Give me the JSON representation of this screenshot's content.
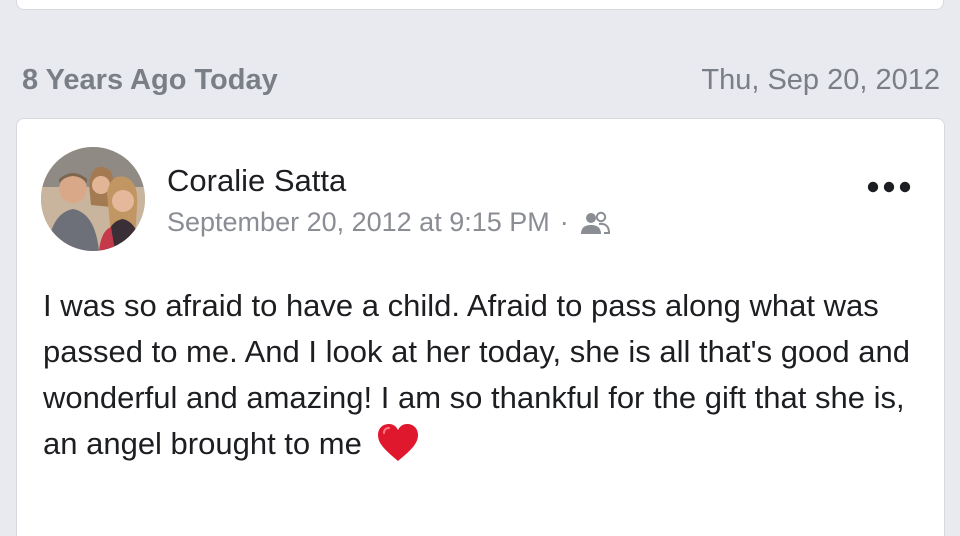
{
  "memory": {
    "label": "8 Years Ago Today",
    "date": "Thu, Sep 20, 2012"
  },
  "post": {
    "author": "Coralie Satta",
    "timestamp": "September 20, 2012 at 9:15 PM",
    "separator": "·",
    "audience_icon": "friends-icon",
    "more_icon": "more-options-icon",
    "text": "I was so afraid to have a child. Afraid to pass along what was passed to me. And I look at her today, she is all that's good and wonderful and amazing! I am so thankful for the gift that she is, an angel brought to me",
    "emoji_icon": "red-heart-icon"
  },
  "colors": {
    "background": "#e9eaef",
    "card": "#ffffff",
    "muted_text": "#7a7e86",
    "heart": "#e0182d"
  }
}
